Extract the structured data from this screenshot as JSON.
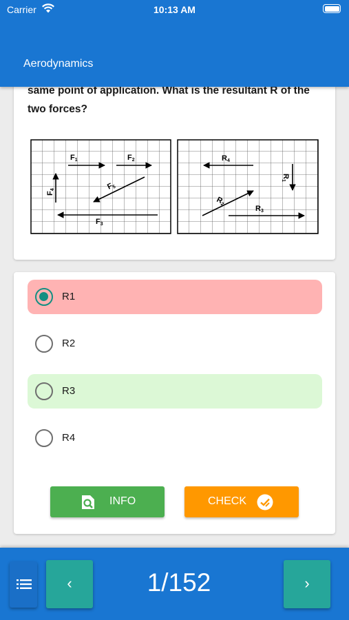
{
  "status_bar": {
    "carrier": "Carrier",
    "time": "10:13 AM"
  },
  "header": {
    "title": "Aerodynamics"
  },
  "question": {
    "text": "same point of application. What is the resultant R of the two forces?",
    "diagram": {
      "left_labels": {
        "f1": "F",
        "f1_sub": "1",
        "f2": "F",
        "f2_sub": "2",
        "f3": "F",
        "f3_sub": "3",
        "f4": "F",
        "f4_sub": "4",
        "f5": "F",
        "f5_sub": "5"
      },
      "right_labels": {
        "r1": "R",
        "r1_sub": "1",
        "r2": "R",
        "r2_sub": "2",
        "r3": "R",
        "r3_sub": "3",
        "r4": "R",
        "r4_sub": "4"
      }
    }
  },
  "options": [
    {
      "label": "R1",
      "state": "selected-wrong"
    },
    {
      "label": "R2",
      "state": "none"
    },
    {
      "label": "R3",
      "state": "correct"
    },
    {
      "label": "R4",
      "state": "none"
    }
  ],
  "buttons": {
    "info_label": "INFO",
    "check_label": "CHECK"
  },
  "navigation": {
    "counter": "1/152",
    "prev_symbol": "‹",
    "next_symbol": "›"
  },
  "colors": {
    "header": "#1976d2",
    "info": "#4caf50",
    "check": "#ff9800",
    "nav": "#26a69a",
    "wrong": "#ffb3b3",
    "correct": "#dcf8d6"
  }
}
